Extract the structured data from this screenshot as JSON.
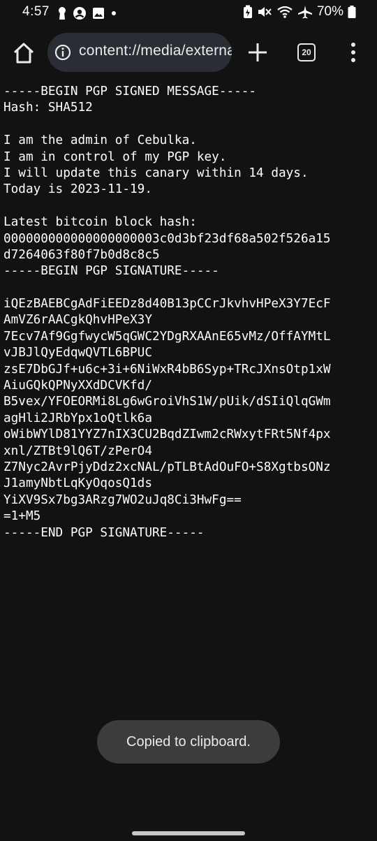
{
  "status_bar": {
    "time": "4:57",
    "battery": "70%",
    "left_icons": [
      "keyhole-icon",
      "account-icon",
      "image-icon",
      "dot-icon"
    ],
    "right_icons": [
      "battery-saver-icon",
      "mute-icon",
      "wifi-icon",
      "airplane-icon",
      "battery-icon"
    ]
  },
  "toolbar": {
    "url": "content://media/external/downloads",
    "tab_count": "20"
  },
  "document": {
    "lines": [
      "-----BEGIN PGP SIGNED MESSAGE-----",
      "Hash: SHA512",
      "",
      "I am the admin of Cebulka.",
      "I am in control of my PGP key.",
      "I will update this canary within 14 days.",
      "Today is 2023-11-19.",
      "",
      "Latest bitcoin block hash:",
      "000000000000000000003c0d3bf23df68a502f526a15",
      "d7264063f80f7b0d8c8c5",
      "-----BEGIN PGP SIGNATURE-----",
      "",
      "iQEzBAEBCgAdFiEEDz8d40B13pCCrJkvhvHPeX3Y7EcF",
      "AmVZ6rAACgkQhvHPeX3Y",
      "7Ecv7Af9GgfwycW5qGWC2YDgRXAAnE65vMz/OffAYMtL",
      "vJBJlQyEdqwQVTL6BPUC",
      "zsE7DbGJf+u6c+3i+6NiWxR4bB6Syp+TRcJXnsOtp1xW",
      "AiuGQkQPNyXXdDCVKfd/",
      "B5vex/YFOEORMi8Lg6wGroiVhS1W/pUik/dSIiQlqGWm",
      "agHli2JRbYpx1oQtlk6a",
      "oWibWYlD81YYZ7nIX3CU2BqdZIwm2cRWxytFRt5Nf4px",
      "xnl/ZTBt9lQ6T/zPerO4",
      "Z7Nyc2AvrPjyDdz2xcNAL/pTLBtAdOuFO+S8XgtbsONz",
      "J1amyNbtLqKyOqosQ1ds",
      "YiXV9Sx7bg3ARzg7WO2uJq8Ci3HwFg==",
      "=1+M5",
      "-----END PGP SIGNATURE-----"
    ]
  },
  "toast": {
    "message": "Copied to clipboard."
  }
}
